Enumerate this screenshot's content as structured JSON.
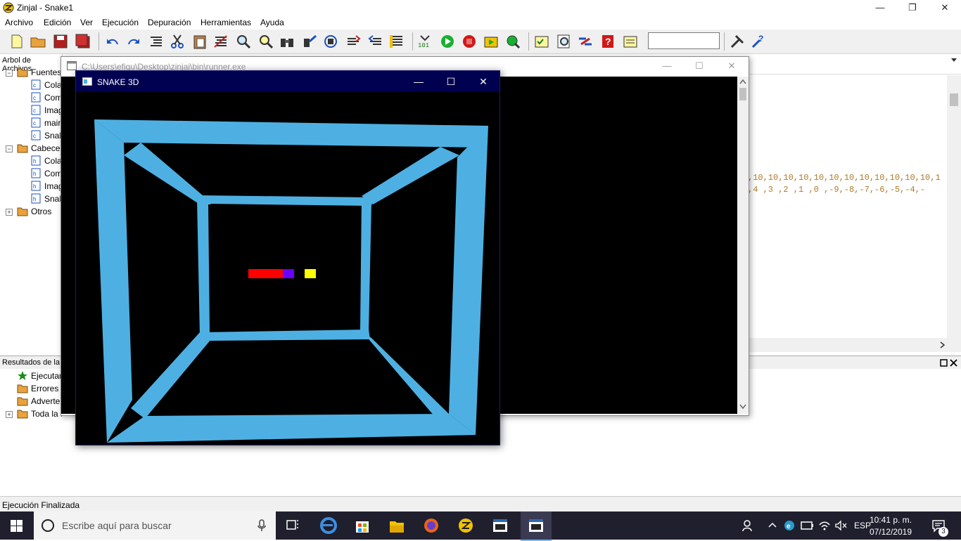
{
  "window": {
    "title": "Zinjal - Snake1",
    "minimize": "—",
    "restore": "❐",
    "close": "✕"
  },
  "menu": [
    "Archivo",
    "Edición",
    "Ver",
    "Ejecución",
    "Depuración",
    "Herramientas",
    "Ayuda"
  ],
  "tree": {
    "caption": "Arbol de Archivos",
    "items": [
      {
        "label": "Fuentes",
        "icon": "folder-open-icon",
        "level": 0
      },
      {
        "label": "Cola",
        "icon": "cpp-file-icon",
        "level": 1
      },
      {
        "label": "Com",
        "icon": "cpp-file-icon",
        "level": 1
      },
      {
        "label": "Imag",
        "icon": "cpp-file-icon",
        "level": 1
      },
      {
        "label": "mair",
        "icon": "cpp-file-icon",
        "level": 1
      },
      {
        "label": "Snak",
        "icon": "cpp-file-icon",
        "level": 1
      },
      {
        "label": "Cabecer",
        "icon": "folder-open-icon",
        "level": 0
      },
      {
        "label": "Cola",
        "icon": "header-file-icon",
        "level": 1
      },
      {
        "label": "Com",
        "icon": "header-file-icon",
        "level": 1
      },
      {
        "label": "Imag",
        "icon": "header-file-icon",
        "level": 1
      },
      {
        "label": "Snak",
        "icon": "header-file-icon",
        "level": 1
      },
      {
        "label": "Otros",
        "icon": "folder-icon",
        "level": 0
      }
    ]
  },
  "editor": {
    "line1": ",10,10,10,10,10,10,10,10,10,10,10,10,1",
    "line2": ",4 ,3 ,2 ,1 ,0 ,-9,-8,-7,-6,-5,-4,-"
  },
  "results": {
    "caption": "Resultados de la",
    "items": [
      {
        "label": "Ejecutar",
        "icon": "green-star-icon"
      },
      {
        "label": "Errores (",
        "icon": "folder-icon"
      },
      {
        "label": "Adverte",
        "icon": "folder-icon"
      },
      {
        "label": "Toda la salida",
        "icon": "folder-icon"
      }
    ]
  },
  "console": {
    "title": "C:\\Users\\efiqu\\Desktop\\zinjai\\bin\\runner.exe"
  },
  "snake_window": {
    "title": "SNAKE 3D",
    "frame_color": "#4eb0e2",
    "snake_body_color": "#ff0000",
    "snake_head_color": "#6a00ff",
    "food_color": "#ffff00"
  },
  "status": {
    "text": "Ejecución Finalizada"
  },
  "taskbar": {
    "search_placeholder": "Escribe aquí para buscar",
    "lang": "ESP",
    "time": "10:41 p. m.",
    "date": "07/12/2019",
    "notifications": "3"
  }
}
